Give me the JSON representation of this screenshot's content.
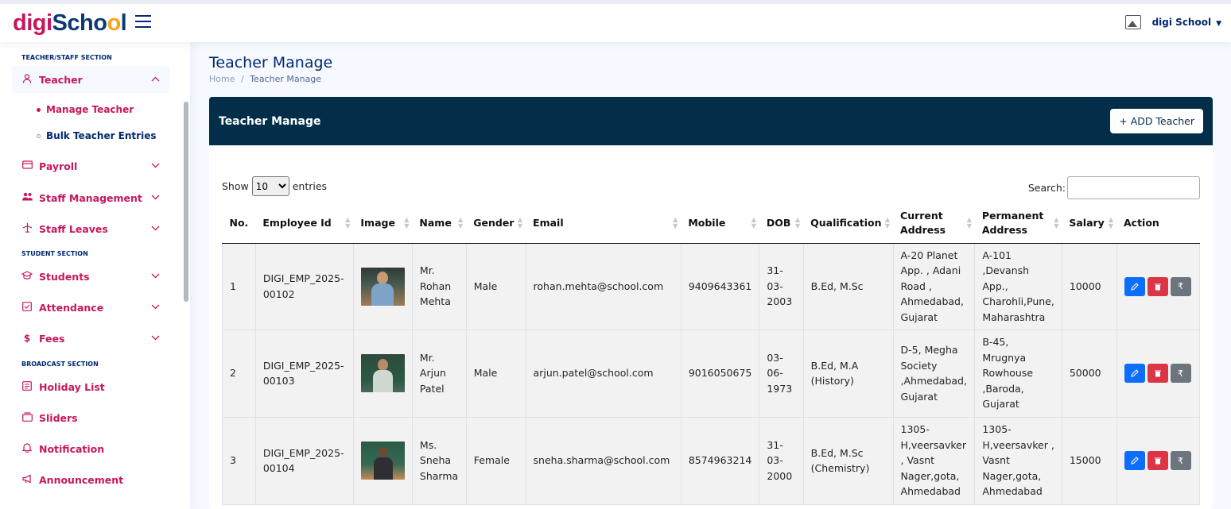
{
  "header": {
    "logo_part1": "digi",
    "logo_part2": "Scho",
    "logo_part3": "o",
    "logo_part4": "l",
    "profile_name": "digi School"
  },
  "sidebar": {
    "teacher_section": "TEACHER/STAFF SECTION",
    "student_section": "STUDENT SECTION",
    "broadcast_section": "BROADCAST SECTION",
    "items": {
      "teacher": "Teacher",
      "manage_teacher": "Manage Teacher",
      "bulk_teacher": "Bulk Teacher Entries",
      "payroll": "Payroll",
      "staff_management": "Staff Management",
      "staff_leaves": "Staff Leaves",
      "students": "Students",
      "attendance": "Attendance",
      "fees": "Fees",
      "holiday_list": "Holiday List",
      "sliders": "Sliders",
      "notification": "Notification",
      "announcement": "Announcement"
    }
  },
  "page": {
    "title": "Teacher Manage",
    "breadcrumb_home": "Home",
    "breadcrumb_sep": "/",
    "breadcrumb_current": "Teacher Manage"
  },
  "card": {
    "title": "Teacher Manage",
    "add_button": "+ ADD Teacher"
  },
  "controls": {
    "show_label": "Show",
    "entries_value": "10",
    "entries_label": "entries",
    "search_label": "Search:"
  },
  "table": {
    "headers": {
      "no": "No.",
      "emp_id": "Employee Id",
      "image": "Image",
      "name": "Name",
      "gender": "Gender",
      "email": "Email",
      "mobile": "Mobile",
      "dob": "DOB",
      "qualification": "Qualification",
      "current_address": "Current Address",
      "permanent_address": "Permanent Address",
      "salary": "Salary",
      "action": "Action"
    },
    "rows": [
      {
        "no": "1",
        "emp_id": "DIGI_EMP_2025-00102",
        "name": "Mr. Rohan Mehta",
        "gender": "Male",
        "email": "rohan.mehta@school.com",
        "mobile": "9409643361",
        "dob": "31-03-2003",
        "qualification": "B.Ed, M.Sc",
        "current_address": "A-20 Planet App. , Adani Road , Ahmedabad, Gujarat",
        "permanent_address": "A-101 ,Devansh App., Charohli,Pune, Maharashtra",
        "salary": "10000"
      },
      {
        "no": "2",
        "emp_id": "DIGI_EMP_2025-00103",
        "name": "Mr. Arjun Patel",
        "gender": "Male",
        "email": "arjun.patel@school.com",
        "mobile": "9016050675",
        "dob": "03-06-1973",
        "qualification": "B.Ed, M.A (History)",
        "current_address": "D-5, Megha Society ,Ahmedabad, Gujarat",
        "permanent_address": "B-45, Mrugnya Rowhouse ,Baroda, Gujarat",
        "salary": "50000"
      },
      {
        "no": "3",
        "emp_id": "DIGI_EMP_2025-00104",
        "name": "Ms. Sneha Sharma",
        "gender": "Female",
        "email": "sneha.sharma@school.com",
        "mobile": "8574963214",
        "dob": "31-03-2000",
        "qualification": "B.Ed, M.Sc (Chemistry)",
        "current_address": "1305-H,veersavker , Vasnt Nager,gota, Ahmedabad",
        "permanent_address": "1305-H,veersavker , Vasnt Nager,gota, Ahmedabad",
        "salary": "15000"
      }
    ]
  },
  "colors": {
    "brand_pink": "#c6175e",
    "brand_navy": "#012970",
    "card_header": "#022e4a",
    "edit": "#0d6efd",
    "delete": "#dc3545",
    "pay": "#6c757d"
  },
  "icons": {
    "edit": "pencil-icon",
    "delete": "trash-icon",
    "pay": "rupee-icon"
  }
}
